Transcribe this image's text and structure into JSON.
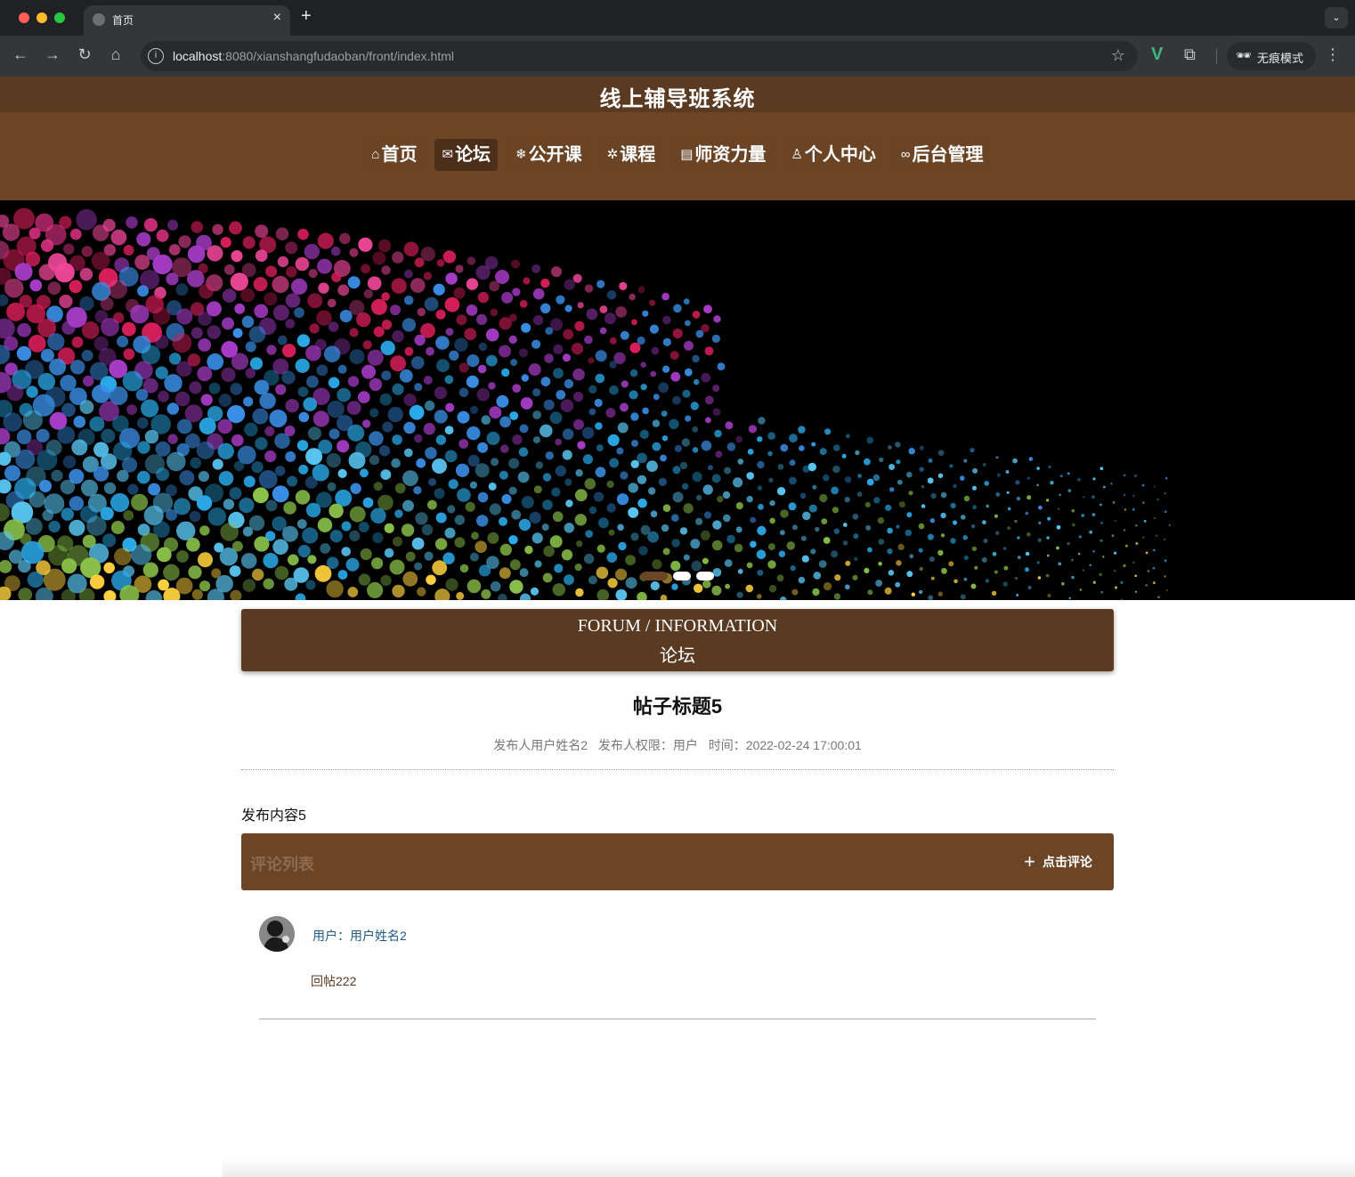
{
  "browser": {
    "tab_title": "首页",
    "url_host": "localhost",
    "url_rest": ":8080/xianshangfudaoban/front/index.html",
    "incognito_label": "无痕模式"
  },
  "site": {
    "title": "线上辅导班系统"
  },
  "nav": {
    "items": [
      {
        "label": "首页",
        "icon": "home-icon"
      },
      {
        "label": "论坛",
        "icon": "mail-icon"
      },
      {
        "label": "公开课",
        "icon": "snowflake-icon"
      },
      {
        "label": "课程",
        "icon": "loop-icon"
      },
      {
        "label": "师资力量",
        "icon": "news-icon"
      },
      {
        "label": "个人中心",
        "icon": "user-icon"
      },
      {
        "label": "后台管理",
        "icon": "link-icon"
      }
    ],
    "active_index": 1
  },
  "carousel": {
    "slide_count": 3,
    "active_index": 0
  },
  "section": {
    "title_en": "FORUM / INFORMATION",
    "title_cn": "论坛"
  },
  "post": {
    "title": "帖子标题5",
    "author": "发布人用户姓名2",
    "role": "发布人权限：用户",
    "time": "时间：2022-02-24 17:00:01",
    "content": "发布内容5"
  },
  "comments": {
    "header": "评论列表",
    "add_label": "点击评论",
    "items": [
      {
        "user": "用户：用户姓名2",
        "text": "回帖222"
      }
    ]
  },
  "colors": {
    "header_brown": "#5b3a22",
    "nav_brown": "#6b4526",
    "link_blue": "#1e5a8a"
  }
}
